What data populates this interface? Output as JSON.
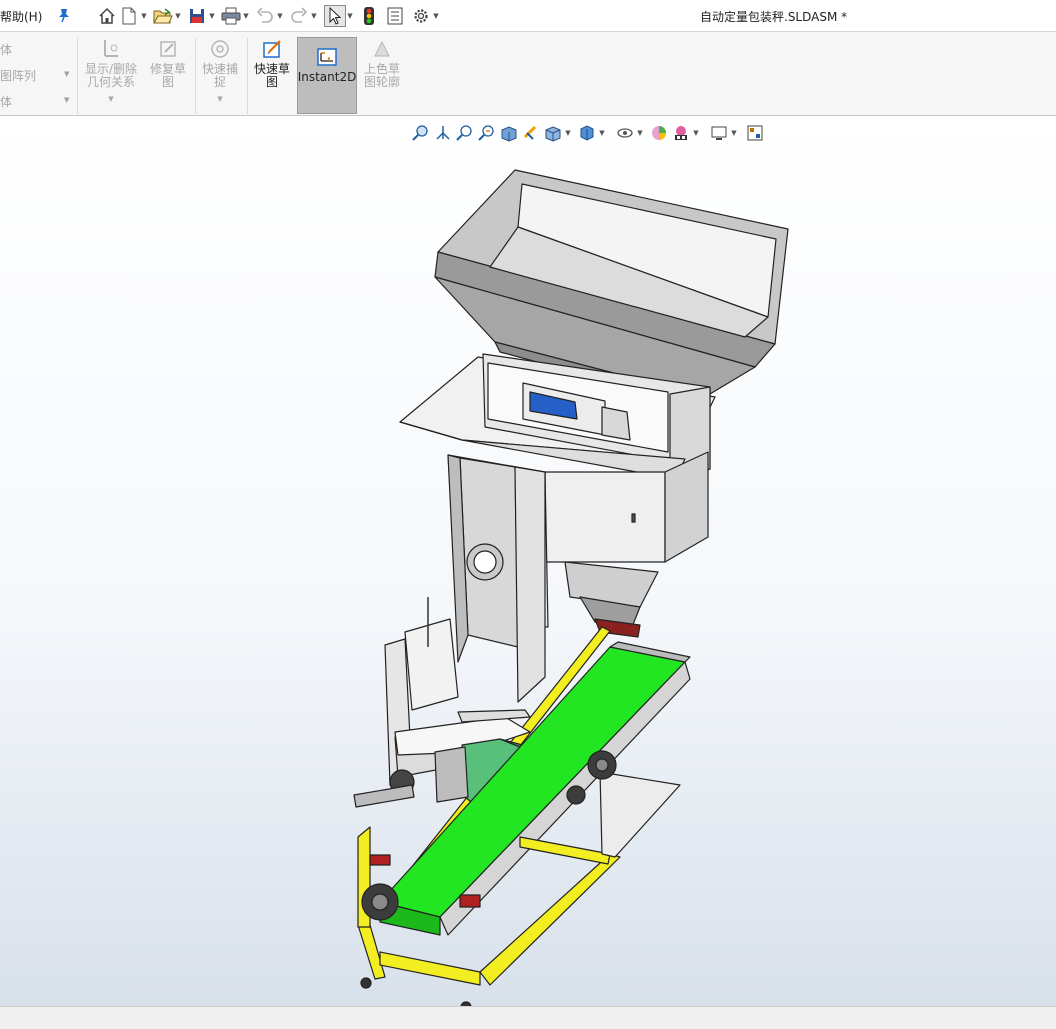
{
  "titlebar": {
    "help_menu": "帮助(H)",
    "document_title": "自动定量包装秤.SLDASM *"
  },
  "quick_access": [
    {
      "name": "home-icon"
    },
    {
      "name": "new-document-icon"
    },
    {
      "name": "open-folder-icon"
    },
    {
      "name": "save-icon"
    },
    {
      "name": "print-icon"
    },
    {
      "name": "undo-icon"
    },
    {
      "name": "redo-icon"
    },
    {
      "name": "select-cursor-icon"
    },
    {
      "name": "rebuild-traffic-light-icon"
    },
    {
      "name": "file-properties-icon"
    },
    {
      "name": "options-gear-icon"
    }
  ],
  "ribbon": {
    "left_labels": [
      "体",
      "图阵列",
      "体"
    ],
    "show_delete_relations": "显示/删除\n几何关系",
    "repair_sketch": "修复草\n图",
    "quick_snaps": "快速捕\n捉",
    "rapid_sketch": "快速草\n图",
    "instant2d": "Instant2D",
    "shaded_sketch_contours": "上色草\n图轮廓"
  },
  "heads_up_toolbar": [
    "zoom-to-fit-icon",
    "zoom-to-area-icon",
    "previous-view-icon",
    "section-view-icon",
    "dynamic-annotation-icon",
    "view-orientation-icon",
    "display-style-icon",
    "hide-show-items-icon",
    "edit-appearance-icon",
    "apply-scene-icon",
    "view-settings-icon",
    "monitor-icon"
  ],
  "colors": {
    "belt_green": "#22e622",
    "frame_yellow": "#f2ee22",
    "active_button": "#bdbdbd",
    "accent_blue": "#1e6fc9"
  }
}
